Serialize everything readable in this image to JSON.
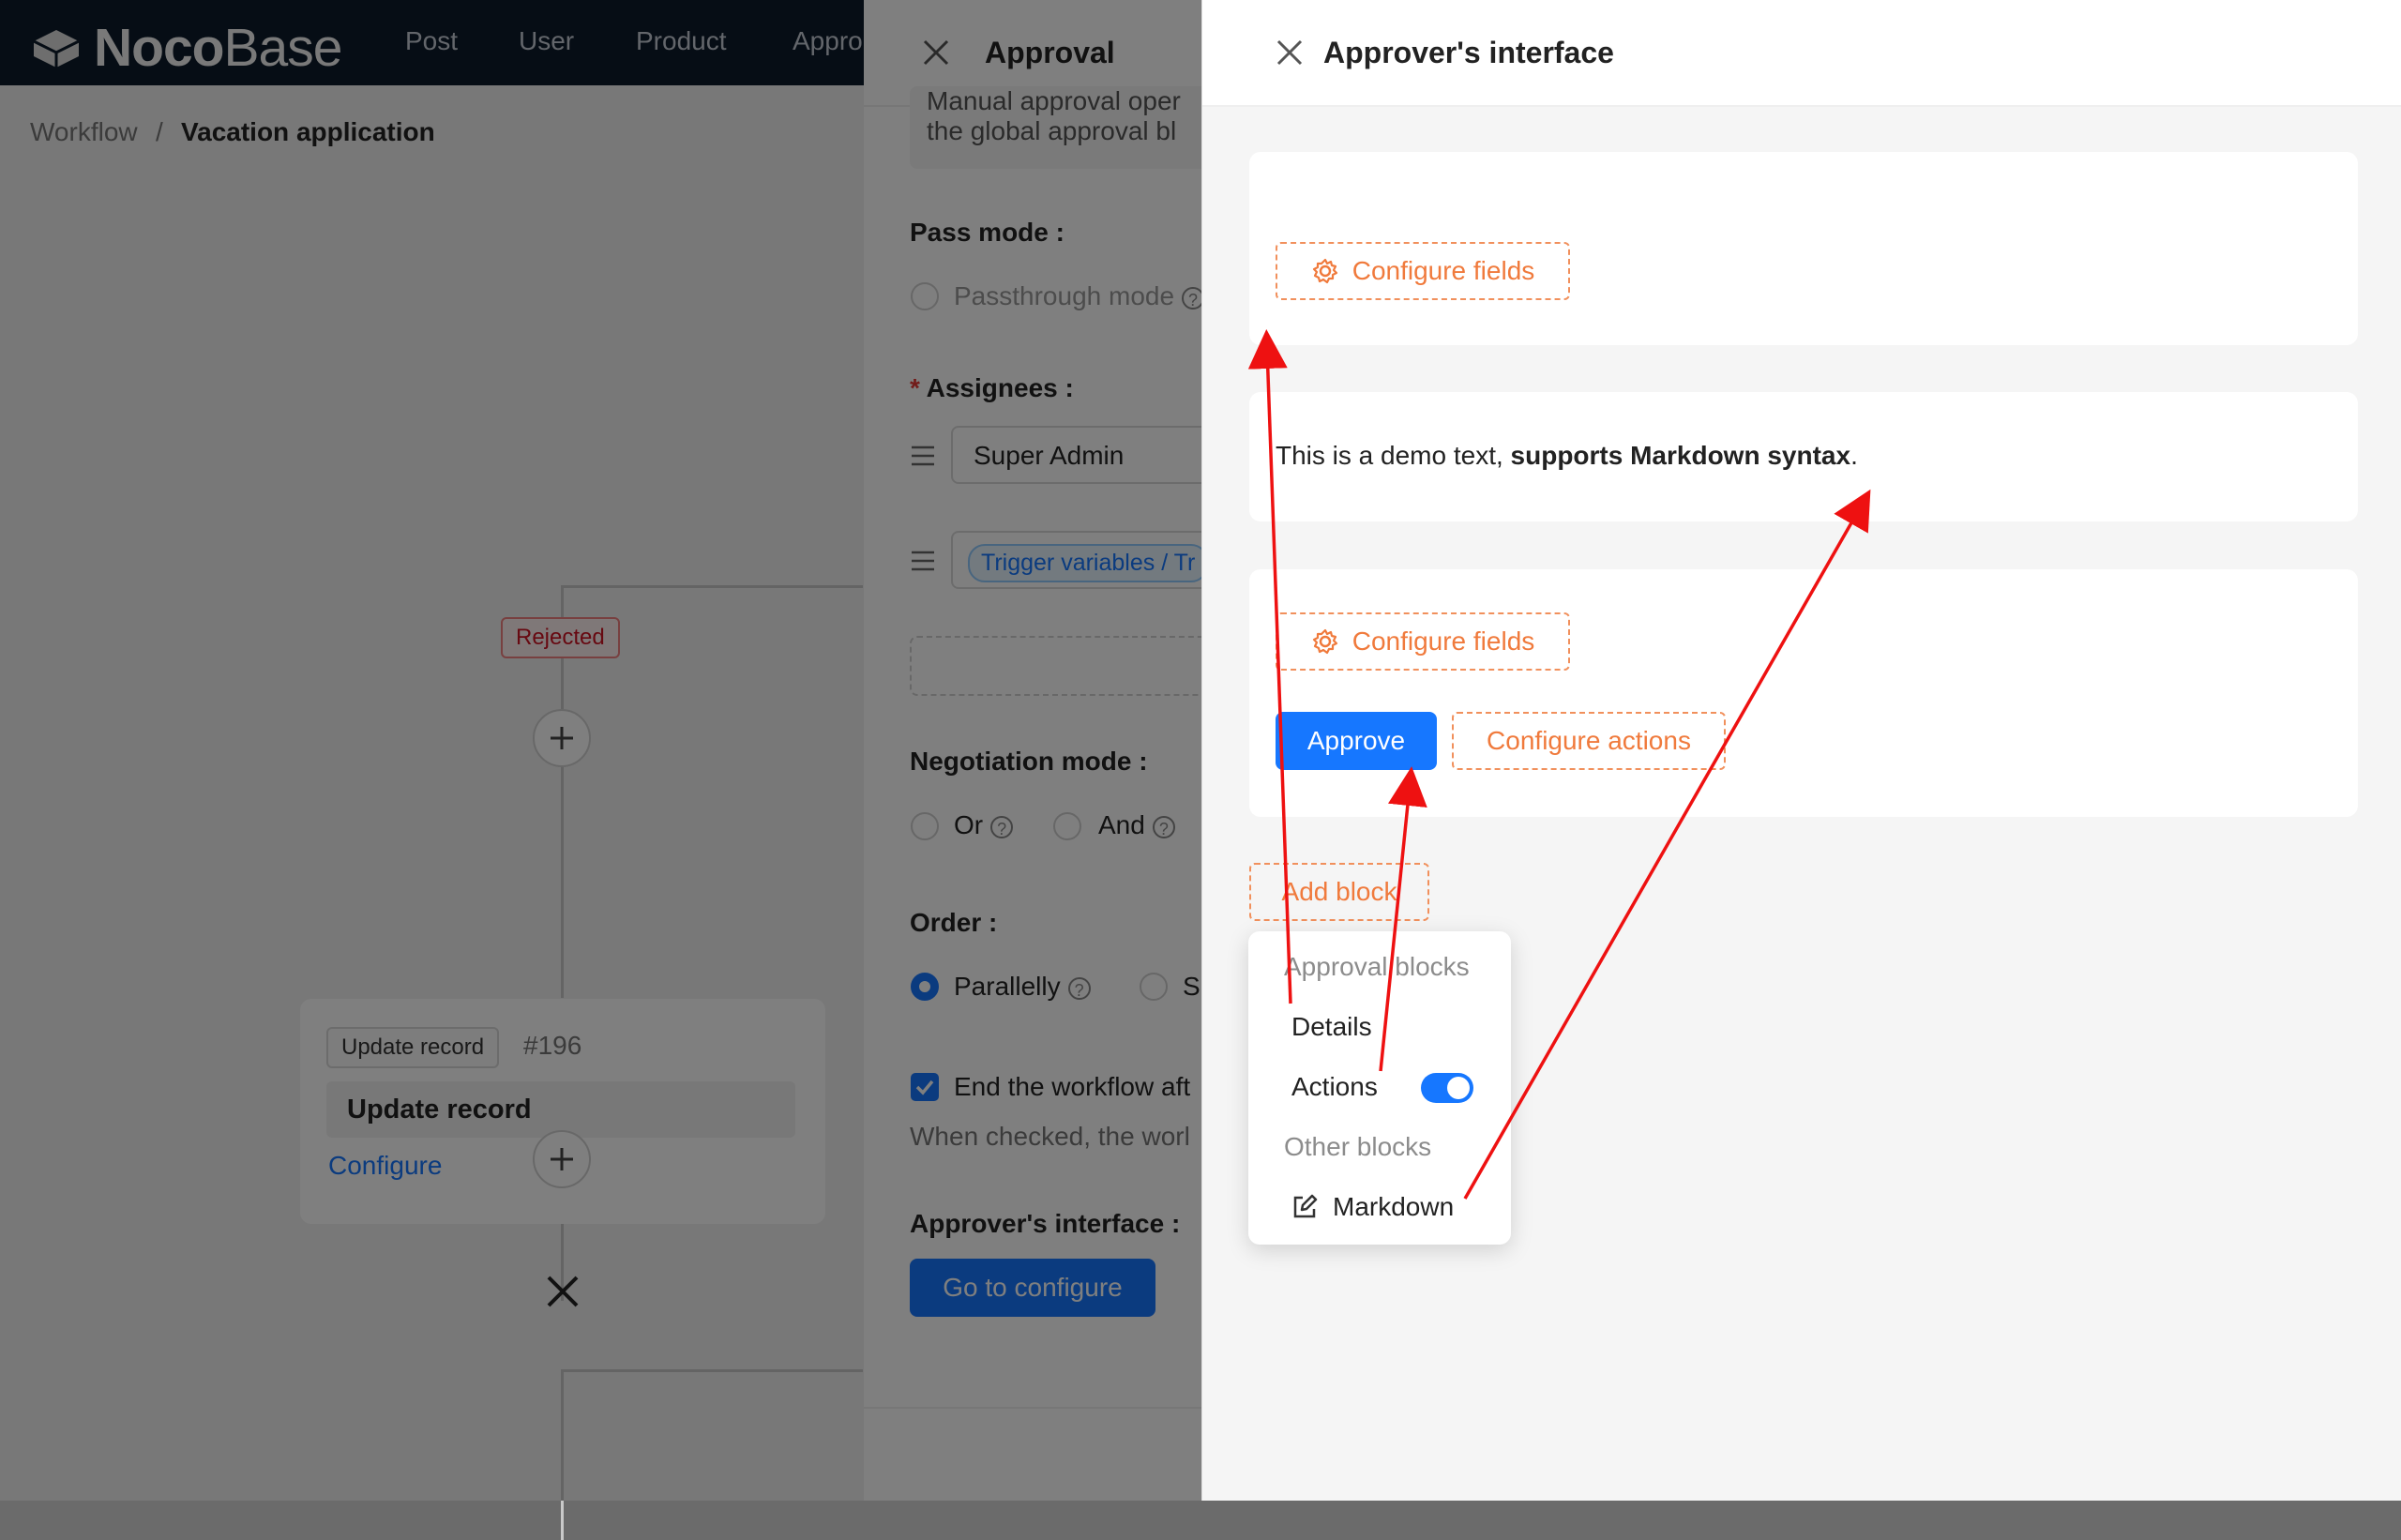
{
  "app": {
    "logo_bold": "Noco",
    "logo_light": "Base",
    "nav": [
      "Post",
      "User",
      "Product",
      "Appro"
    ]
  },
  "breadcrumb": {
    "root": "Workflow",
    "separator": "/",
    "current": "Vacation application"
  },
  "flow": {
    "rejected_tag": "Rejected",
    "node": {
      "type_tag": "Update record",
      "id": "#196",
      "title": "Update record",
      "configure_link": "Configure"
    }
  },
  "approval_drawer": {
    "title": "Approval",
    "description_line1": "Manual approval oper",
    "description_line2": "the global approval bl",
    "pass_mode": {
      "label": "Pass mode",
      "option": "Passthrough mode"
    },
    "assignees": {
      "label": "Assignees",
      "item1": "Super Admin",
      "item2_tag": "Trigger variables / Tr"
    },
    "negotiation": {
      "label": "Negotiation mode",
      "or": "Or",
      "and": "And"
    },
    "order": {
      "label": "Order",
      "parallel": "Parallelly",
      "sequential": "S"
    },
    "end_workflow": {
      "checkbox_label": "End the workflow aft",
      "hint": "When checked, the worl"
    },
    "approver_interface": {
      "label": "Approver's interface",
      "button": "Go to configure"
    },
    "colon": ":"
  },
  "approver_drawer": {
    "title": "Approver's interface",
    "configure_fields": "Configure fields",
    "markdown_text_plain": "This is a demo text, ",
    "markdown_text_bold": "supports Markdown syntax",
    "markdown_text_end": ".",
    "approve_button": "Approve",
    "configure_actions": "Configure actions",
    "add_block": "Add block",
    "menu": {
      "group1": "Approval blocks",
      "details": "Details",
      "actions": "Actions",
      "actions_enabled": true,
      "group2": "Other blocks",
      "markdown": "Markdown"
    }
  },
  "colors": {
    "primary": "#1677ff",
    "accent_orange": "#f07a3c",
    "annotation_red": "#ee1111",
    "reject_red": "#cf1322",
    "header_bg": "#0d1b2a"
  },
  "icons": {
    "close": "close-icon",
    "gear": "gear-icon",
    "edit": "edit-icon",
    "drag": "drag-handle-icon",
    "plus": "plus-icon",
    "end": "end-x-icon",
    "question": "question-icon"
  }
}
